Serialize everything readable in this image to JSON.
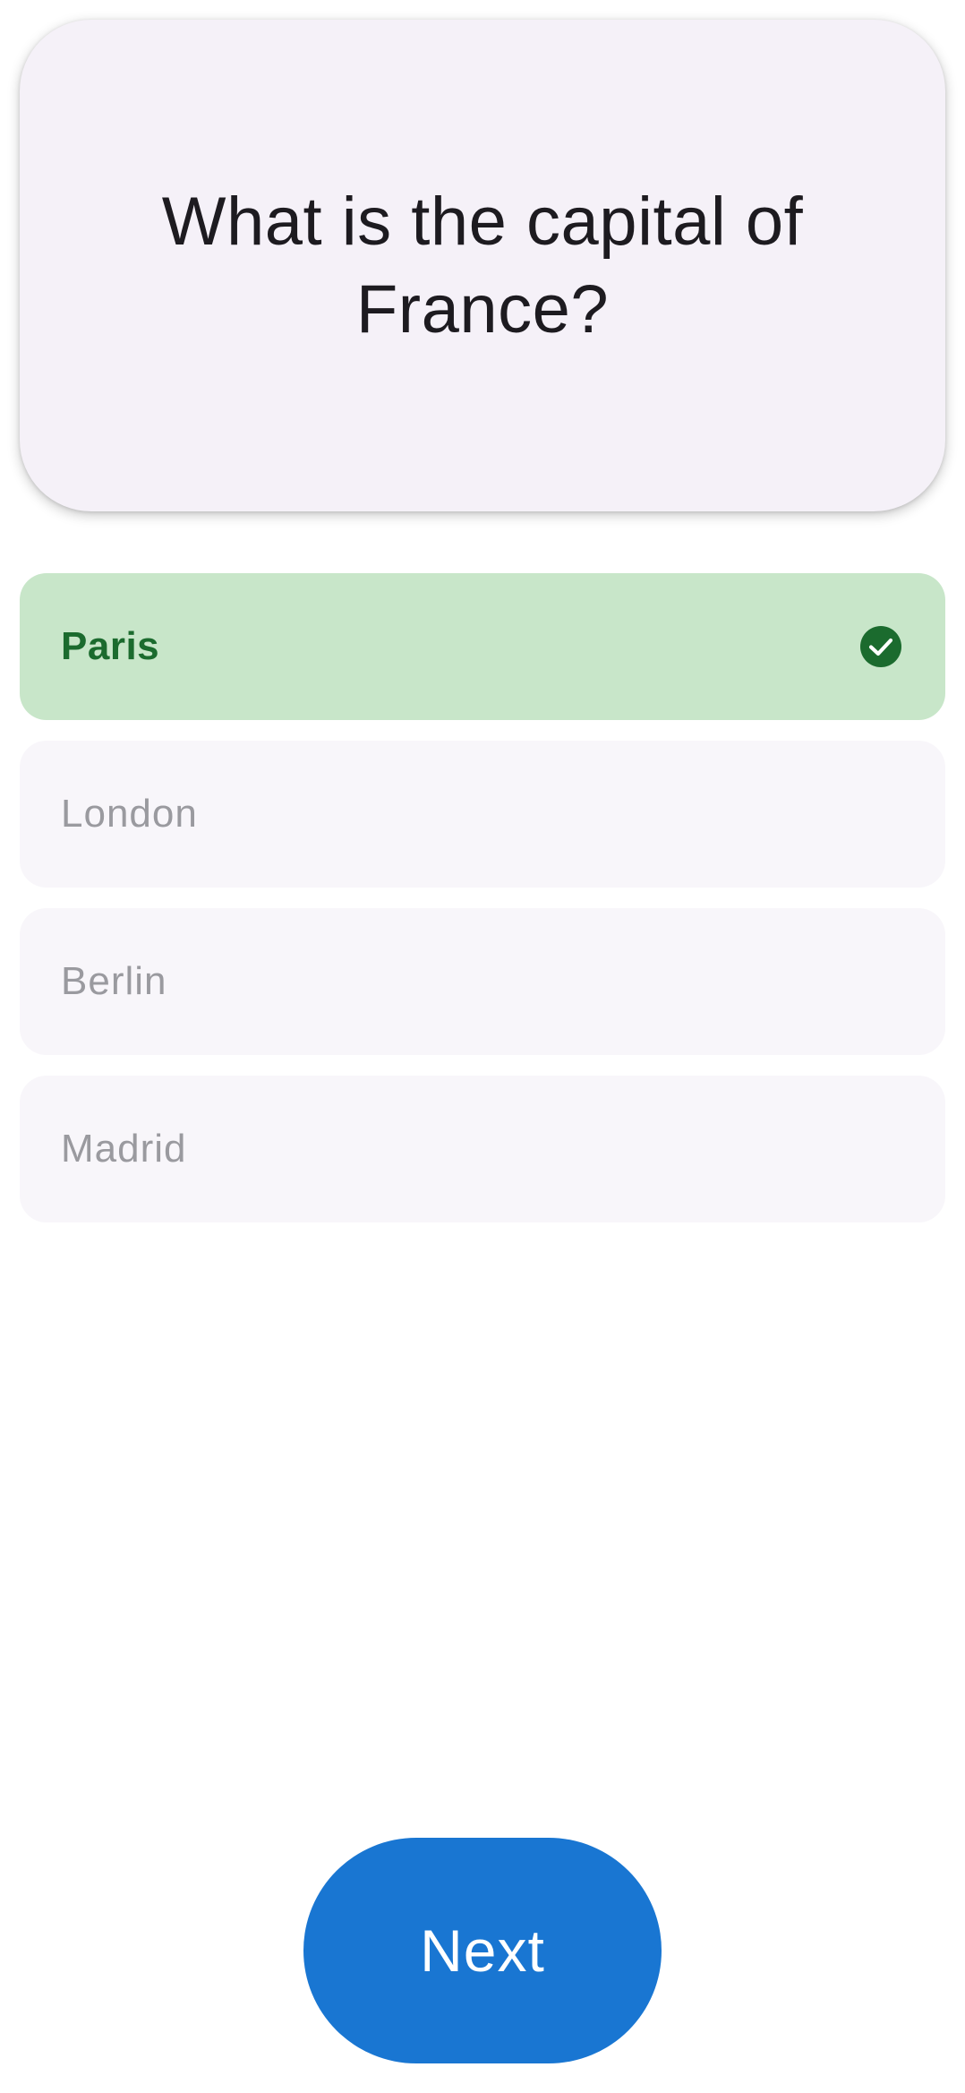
{
  "question": {
    "text": "What is the capital of France?"
  },
  "options": [
    {
      "label": "Paris",
      "state": "correct",
      "icon": "check-circle-icon"
    },
    {
      "label": "London",
      "state": "disabled"
    },
    {
      "label": "Berlin",
      "state": "disabled"
    },
    {
      "label": "Madrid",
      "state": "disabled"
    }
  ],
  "next_button": {
    "label": "Next"
  },
  "colors": {
    "card_background": "#f5f1f8",
    "correct_background": "#c8e6c9",
    "correct_foreground": "#1b6b2e",
    "option_background": "#f8f6fa",
    "option_text": "#9a9a9f",
    "primary": "#1976d2"
  }
}
